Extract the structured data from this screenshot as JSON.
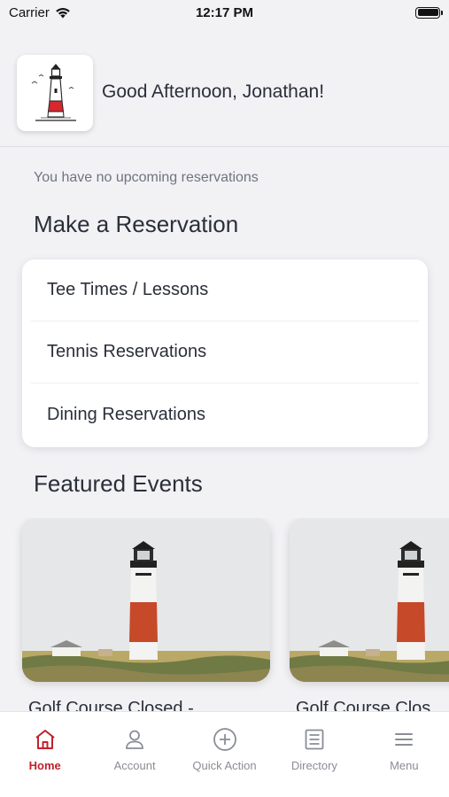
{
  "status_bar": {
    "carrier": "Carrier",
    "time": "12:17 PM"
  },
  "header": {
    "greeting": "Good Afternoon, Jonathan!"
  },
  "reservations": {
    "empty_message": "You have no upcoming reservations",
    "section_title": "Make a Reservation",
    "items": [
      {
        "label": "Tee Times / Lessons"
      },
      {
        "label": "Tennis Reservations"
      },
      {
        "label": "Dining Reservations"
      }
    ]
  },
  "events": {
    "section_title": "Featured Events",
    "items": [
      {
        "title": "Golf Course Closed -"
      },
      {
        "title": "Golf Course Clos"
      }
    ]
  },
  "tab_bar": {
    "active_color": "#c0222d",
    "items": [
      {
        "label": "Home",
        "icon": "home-icon",
        "active": true
      },
      {
        "label": "Account",
        "icon": "person-icon",
        "active": false
      },
      {
        "label": "Quick Action",
        "icon": "plus-circle-icon",
        "active": false
      },
      {
        "label": "Directory",
        "icon": "document-list-icon",
        "active": false
      },
      {
        "label": "Menu",
        "icon": "hamburger-menu-icon",
        "active": false
      }
    ]
  }
}
